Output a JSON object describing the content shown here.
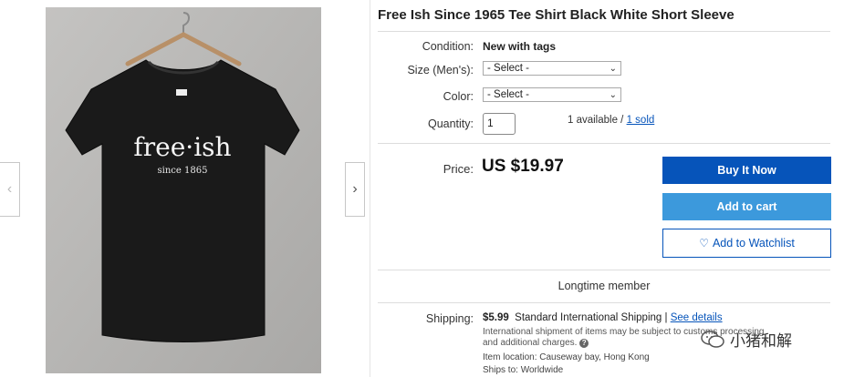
{
  "gallery": {
    "shirt_print_main": "free·ish",
    "shirt_print_sub": "since 1865",
    "prev_icon": "chevron-left-icon",
    "next_icon": "chevron-right-icon"
  },
  "item": {
    "title": "Free Ish Since 1965 Tee Shirt Black White Short Sleeve"
  },
  "details": {
    "condition_label": "Condition:",
    "condition_value": "New with tags",
    "size_label": "Size (Men's):",
    "size_selected": "- Select -",
    "color_label": "Color:",
    "color_selected": "- Select -",
    "quantity_label": "Quantity:",
    "quantity_value": "1",
    "available_text": "1 available /",
    "sold_link": "1 sold"
  },
  "pricing": {
    "price_label": "Price:",
    "price_value": "US $19.97"
  },
  "actions": {
    "buy_now": "Buy It Now",
    "add_to_cart": "Add to cart",
    "add_to_watchlist": "Add to Watchlist"
  },
  "seller": {
    "member_text": "Longtime member"
  },
  "shipping": {
    "label": "Shipping:",
    "cost": "$5.99",
    "method": "Standard International Shipping |",
    "details_link": "See details",
    "note": "International shipment of items may be subject to customs processing and additional charges.",
    "item_location": "Item location:  Causeway bay, Hong Kong",
    "ships_to": "Ships to:  Worldwide"
  },
  "watermark": {
    "text": "小猪和解"
  },
  "colors": {
    "buy_button": "#0654ba",
    "cart_button": "#3c99dc",
    "link": "#0654ba"
  }
}
